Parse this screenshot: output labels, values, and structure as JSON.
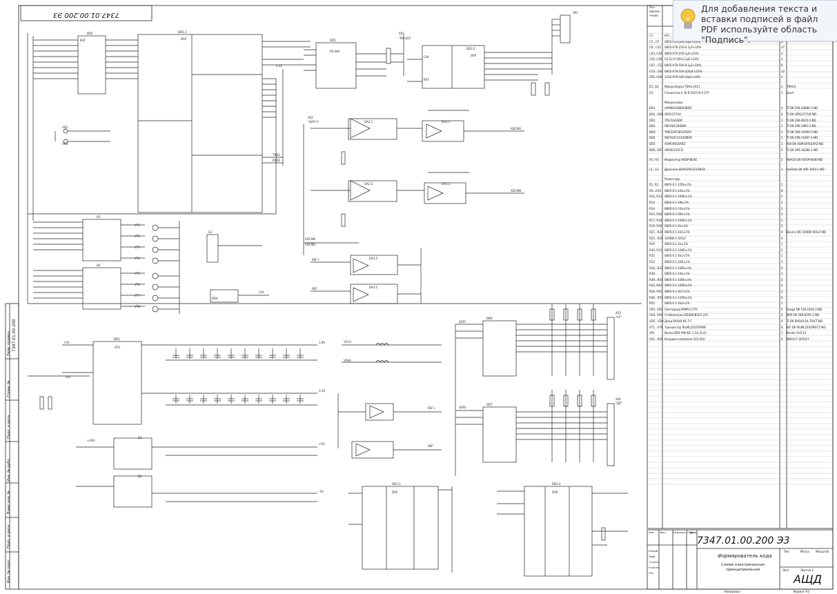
{
  "pdf_hint": {
    "icon": "lightbulb-icon",
    "text": "Для добавления текста и вставки подписей в файл PDF используйте область \"Подпись\"."
  },
  "sheet": {
    "top_code": "7347.01.00.200 Э3",
    "side_code": "7347.01.00.200",
    "title_block": {
      "code": "7347.01.00.200  Э3",
      "title": "Формирователь кода",
      "subtitle_line1": "Схема электрическая",
      "subtitle_line2": "принципиальная",
      "org": "АЩД",
      "lit": "Лит.",
      "mass": "Масса",
      "scale": "Масштаб",
      "sheet": "Лист",
      "sheets": "Листов  1",
      "roles": [
        "Изм.",
        "Лист",
        "№ докум.",
        "Подп.",
        "Дата",
        "Разраб.",
        "Пров.",
        "Т.контр.",
        "Н.контр.",
        "Утв."
      ],
      "format": "Формат  А3",
      "copied": "Копировал"
    },
    "bom_header": [
      "Поз. обозна-чение",
      "Наименование",
      "Кол.",
      "Примечание"
    ],
    "bom_rows": [
      [
        "C1",
        "HCI...",
        "1",
        ""
      ],
      [
        "C2...C5",
        "0805-X7R-16V-16pF±10%",
        "4",
        ""
      ],
      [
        "C6...C42",
        "0805-X7R-25V-0.1μF±10%",
        "37",
        ""
      ],
      [
        "C43, C44",
        "0805-X7R-25V-1μF±10%",
        "2",
        ""
      ],
      [
        "C45, C46",
        "C4-22 A-16V-2.2μF±10%",
        "2",
        ""
      ],
      [
        "C47...C52",
        "0805-X7R-50V-0.1μF±10%",
        "6",
        ""
      ],
      [
        "C53...C64",
        "0805-X7R-50V-220pF±10%",
        "12",
        ""
      ],
      [
        "C65, C66",
        "1210-X7R-16V-10μF±10%",
        "2",
        ""
      ],
      [
        "D1, D2",
        "Микросборка TEHS-2411",
        "2",
        "TRACO"
      ],
      [
        "G1",
        "Генератор 0.30.8-1015-B-3-27t",
        "1",
        "Jauch"
      ],
      [
        "",
        "Микросхемы",
        "",
        ""
      ],
      [
        "DA1",
        "LMH6643D8DQBDR",
        "4",
        "TI DK 296-20886-1-ND"
      ],
      [
        "DA2...DA5",
        "OPA2277UA",
        "4",
        "TI DK OPA2277UA-ND"
      ],
      [
        "DD1",
        "TPS76433DR",
        "1",
        "TI DK 296-9635-5-ND"
      ],
      [
        "DD2",
        "SN74HC240DW",
        "1",
        "TI DK 296-1682-2-ND"
      ],
      [
        "DD3",
        "TMS320F2812PGFA",
        "1",
        "TI DK 296-15995-5-ND"
      ],
      [
        "DD4",
        "SN74LVC1G14DBVR",
        "1",
        "TI DK 296-11607-1-ND"
      ],
      [
        "DD5",
        "ADM3491EARZ",
        "1",
        "ADI DK ADM3491EARZ-ND"
      ],
      [
        "DD6, DD7",
        "AM26LV32CD",
        "2",
        "TI DK 296-18186-1-ND"
      ],
      [
        "H1, H2",
        "Индикатор HDSP-B04E",
        "2",
        "AVAGO DK HDSP-B04E-ND"
      ],
      [
        "L1...L3",
        "Дроссель BLM21PG221SN1D",
        "3",
        "muRata DK 490-1054-1-ND"
      ],
      [
        "",
        "Резисторы",
        "",
        ""
      ],
      [
        "R1, R2",
        "0805-0.1-150k±1%",
        "2",
        ""
      ],
      [
        "R3...R10",
        "0805-0.1-10k±1%",
        "8",
        ""
      ],
      [
        "R11, R12",
        "0805-0.1-240R±1%",
        "2",
        ""
      ],
      [
        "R13",
        "0805-0.1-1M±1%",
        "1",
        ""
      ],
      [
        "R14",
        "0805-0.1-51k±1%",
        "1",
        ""
      ],
      [
        "R15, R16",
        "0805-0.1-39k±1%",
        "2",
        ""
      ],
      [
        "R17, R18",
        "0805-0.1-100R±1%",
        "2",
        ""
      ],
      [
        "R19, R20",
        "0805-0.1-2k±1%",
        "2",
        ""
      ],
      [
        "R21...R24",
        "0805-0.1-1k5±1%",
        "4",
        "Bourns DK 3296W-501LF-ND"
      ],
      [
        "R25...R28",
        "3296W-1-501LF",
        "4",
        ""
      ],
      [
        "R29",
        "0805-0.1-2k±1%",
        "1",
        ""
      ],
      [
        "R30, R31",
        "0805-0.1-100R±1%",
        "2",
        ""
      ],
      [
        "R32",
        "0805-0.1-5k1±1%",
        "1",
        ""
      ],
      [
        "R33",
        "0805-0.1-10R±1%",
        "1",
        ""
      ],
      [
        "R34...R37",
        "0805-0.1-100k±1%",
        "4",
        ""
      ],
      [
        "R38",
        "0805-0.1-10k±1%",
        "1",
        ""
      ],
      [
        "R39...R41",
        "0805-0.1-100k±1%",
        "3",
        ""
      ],
      [
        "R42, R43",
        "0805-0.1-100R±1%",
        "2",
        ""
      ],
      [
        "R44, R45",
        "0805-0.1-4k7±1%",
        "2",
        ""
      ],
      [
        "R46...R51",
        "0805-0.1-120R±1%",
        "6",
        ""
      ],
      [
        "R52",
        "0805-0.1-2k4±1%",
        "1",
        ""
      ],
      [
        "VD1, VD2",
        "Светодиод HSMS-C170",
        "2",
        "Avago DK 516-1434-2-ND"
      ],
      [
        "VD3, VD4",
        "Стабилитрон BZX84-B3V3.215",
        "2",
        "NXP DK 568-6295-1-ND"
      ],
      [
        "VD5...VD8",
        "Диод BAS40-04-7-F",
        "4",
        "TI DK BAS40-04-7DICT-ND"
      ],
      [
        "VT1...VT8",
        "Транзистор IRLML2502TRPBF",
        "8",
        "IRF DK IRLML2502PBFCT-ND"
      ],
      [
        "XP1",
        "Вилка DD4 PIN IDC 2.54 (2x5)",
        "1",
        "Binder PLD-14"
      ],
      [
        "XS1...XS4",
        "Колодка клеммная 233-204",
        "4",
        "WAGO F 005527"
      ]
    ],
    "left_stamp_labels": [
      "Перв. примен.",
      "Справ. №",
      "Подп. и дата",
      "Инв. № дубл.",
      "Взам. инв. №",
      "Подп. и дата",
      "Инв. № подл."
    ]
  },
  "schematic": {
    "parts": [
      {
        "ref": "DD2",
        "type": "BUF",
        "label": "DD2"
      },
      {
        "ref": "DD3.1",
        "type": "DSP",
        "label": "DD3.1"
      },
      {
        "ref": "DD5",
        "type": "RS-485",
        "label": "DD5"
      },
      {
        "ref": "DD3.2",
        "type": "DSP",
        "label": "DD3.2"
      },
      {
        "ref": "DD3.3",
        "type": "DSP",
        "label": "DD3.3"
      },
      {
        "ref": "DD3.4",
        "type": "DSP",
        "label": "DD3.4"
      },
      {
        "ref": "DD1",
        "type": "STU",
        "label": "DD1"
      },
      {
        "ref": "DD6",
        "type": "AM26",
        "label": "DD6"
      },
      {
        "ref": "DD7",
        "type": "AM26",
        "label": "DD7"
      },
      {
        "ref": "H1",
        "type": "LED",
        "label": "H1"
      },
      {
        "ref": "H2",
        "type": "LED",
        "label": "H2"
      },
      {
        "ref": "D1",
        "type": "DC/DC",
        "label": "D1"
      },
      {
        "ref": "D2",
        "type": "DC/DC",
        "label": "D2"
      },
      {
        "ref": "XP1",
        "type": "header",
        "label": "XP1"
      },
      {
        "ref": "XS1",
        "type": "connector",
        "label": "XS1 \"RS-422\""
      },
      {
        "ref": "XS2",
        "type": "connector",
        "label": "XS2 \"ЦАП-1\""
      },
      {
        "ref": "XS3",
        "type": "connector",
        "label": "XS3 \"А2\""
      },
      {
        "ref": "XS4",
        "type": "connector",
        "label": "XS4 \"ДП\""
      }
    ],
    "opamps": [
      "DA2.1",
      "DA2.2",
      "DA3.1",
      "DA3.2",
      "DA4.1",
      "DA4.2",
      "DA5.1"
    ],
    "nets": [
      "+5V",
      "3,3V",
      "1,9V",
      "VCCA",
      "VSSA",
      "+24V",
      "-5V",
      "ADCIN0",
      "ADCIN1",
      "REF+",
      "REF-",
      "GEP1",
      "GEP2",
      "TXD2",
      "RXD2",
      "CLK",
      "RST"
    ]
  }
}
